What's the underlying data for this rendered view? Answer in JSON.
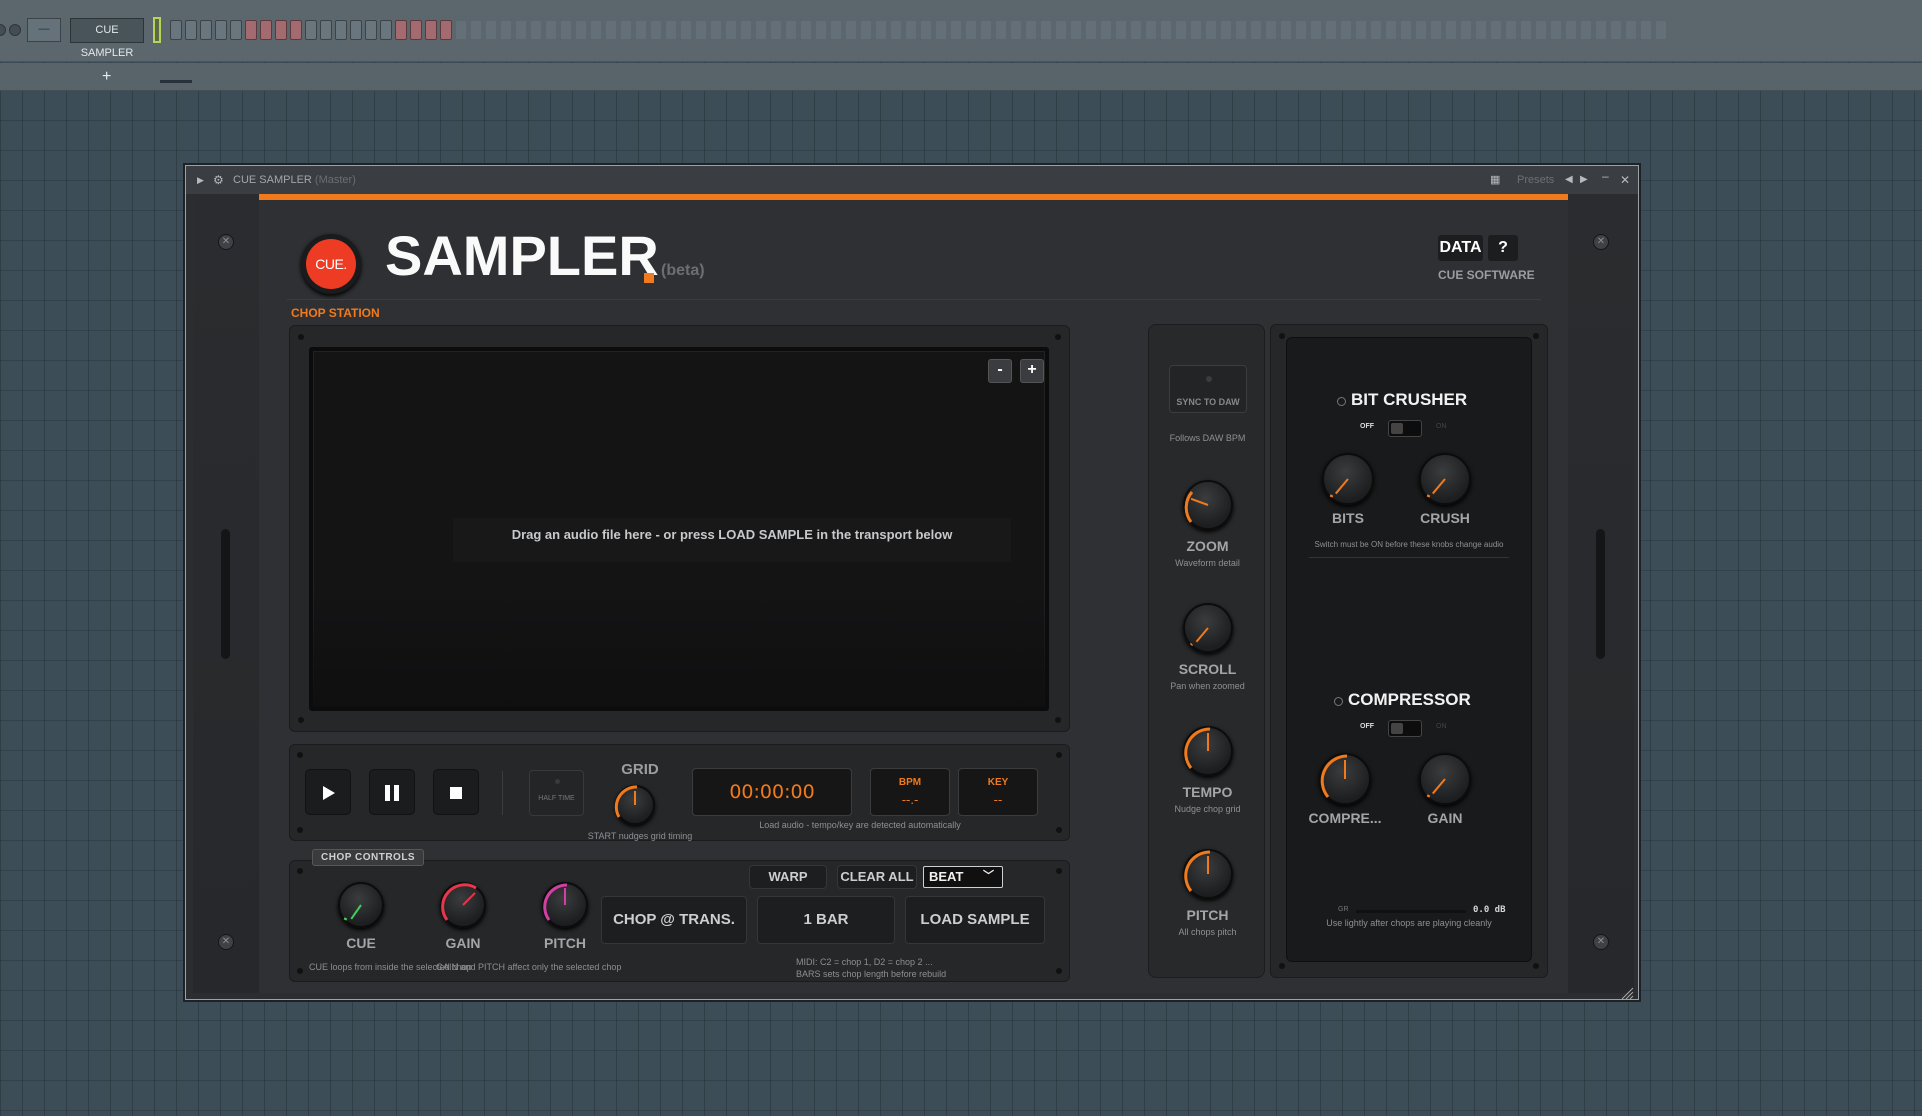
{
  "daw": {
    "channel_name": "CUE SAMPLER",
    "add_symbol": "+",
    "mini_label": "—",
    "steps": [
      "n",
      "n",
      "n",
      "n",
      "n",
      "r",
      "r",
      "r",
      "r",
      "n",
      "n",
      "n",
      "n",
      "n",
      "n",
      "r",
      "r",
      "r",
      "r",
      "d",
      "d",
      "d",
      "d",
      "d",
      "d",
      "d",
      "d",
      "d",
      "d",
      "d",
      "d",
      "d",
      "d",
      "d",
      "d",
      "d",
      "d",
      "d",
      "d",
      "d",
      "d",
      "d",
      "d",
      "d",
      "d",
      "d",
      "d",
      "d",
      "d",
      "d",
      "d",
      "d",
      "d",
      "d",
      "d",
      "d",
      "d",
      "d",
      "d",
      "d",
      "d",
      "d",
      "d",
      "d",
      "d",
      "d",
      "d",
      "d",
      "d",
      "d",
      "d",
      "d",
      "d",
      "d",
      "d",
      "d",
      "d",
      "d",
      "d",
      "d",
      "d",
      "d",
      "d",
      "d",
      "d",
      "d",
      "d",
      "d",
      "d",
      "d",
      "d",
      "d",
      "d",
      "d",
      "d",
      "d",
      "d",
      "d",
      "d",
      "d"
    ]
  },
  "window": {
    "title": "CUE SAMPLER",
    "title_suffix": "(Master)",
    "presets_label": "Presets",
    "minimize_symbol": "‒",
    "close_symbol": "✕"
  },
  "header": {
    "logo_text": "CUE.",
    "title": "SAMPLER",
    "beta": "(beta)",
    "data_button": "DATA",
    "help_button": "?",
    "brand": "CUE SOFTWARE",
    "section_label": "CHOP STATION"
  },
  "waveform": {
    "drop_message": "Drag an audio file here - or press LOAD SAMPLE in the transport below",
    "zoom_out": "-",
    "zoom_in": "+"
  },
  "transport": {
    "half_time": "HALF TIME",
    "grid_label": "GRID",
    "grid_note": "START nudges grid timing",
    "time": "00:00:00",
    "bpm_label": "BPM",
    "bpm_value": "--.-",
    "key_label": "KEY",
    "key_value": "--",
    "detect_note": "Load audio - tempo/key are detected automatically"
  },
  "chop": {
    "tab_label": "CHOP CONTROLS",
    "knobs": [
      {
        "label": "CUE"
      },
      {
        "label": "GAIN"
      },
      {
        "label": "PITCH"
      }
    ],
    "warp": "WARP",
    "clear_all": "CLEAR ALL",
    "beat_value": "BEAT",
    "chop_trans": "CHOP @ TRANS.",
    "bars": "1 BAR",
    "load_sample": "LOAD SAMPLE",
    "note_cue": "CUE loops from inside the selected chop",
    "note_gain": "GAIN and PITCH affect only the selected chop",
    "midi_note": "MIDI: C2 = chop 1,  D2 = chop 2 ...",
    "bars_note": "BARS sets chop length before rebuild"
  },
  "middle": {
    "sync_label": "SYNC TO DAW",
    "sync_note": "Follows DAW BPM",
    "knobs": [
      {
        "label": "ZOOM",
        "sub": "Waveform detail"
      },
      {
        "label": "SCROLL",
        "sub": "Pan when zoomed"
      },
      {
        "label": "TEMPO",
        "sub": "Nudge chop grid"
      },
      {
        "label": "PITCH",
        "sub": "All chops pitch"
      }
    ]
  },
  "fx": {
    "bitcrusher": {
      "title": "BIT CRUSHER",
      "off": "OFF",
      "on": "ON",
      "knob1": "BITS",
      "knob2": "CRUSH",
      "note": "Switch must be ON before these knobs change audio"
    },
    "compressor": {
      "title": "COMPRESSOR",
      "off": "OFF",
      "on": "ON",
      "knob1": "COMPRE...",
      "knob2": "GAIN",
      "gr_label": "GR",
      "gr_value": "0.0 dB",
      "note": "Use lightly after chops are playing cleanly"
    }
  },
  "colors": {
    "accent": "#f07a1c",
    "logo_red": "#ee3b24",
    "cue_knob": "#3fcf5a",
    "gain_knob": "#e8364a",
    "pitch_knob": "#d43fa3"
  }
}
